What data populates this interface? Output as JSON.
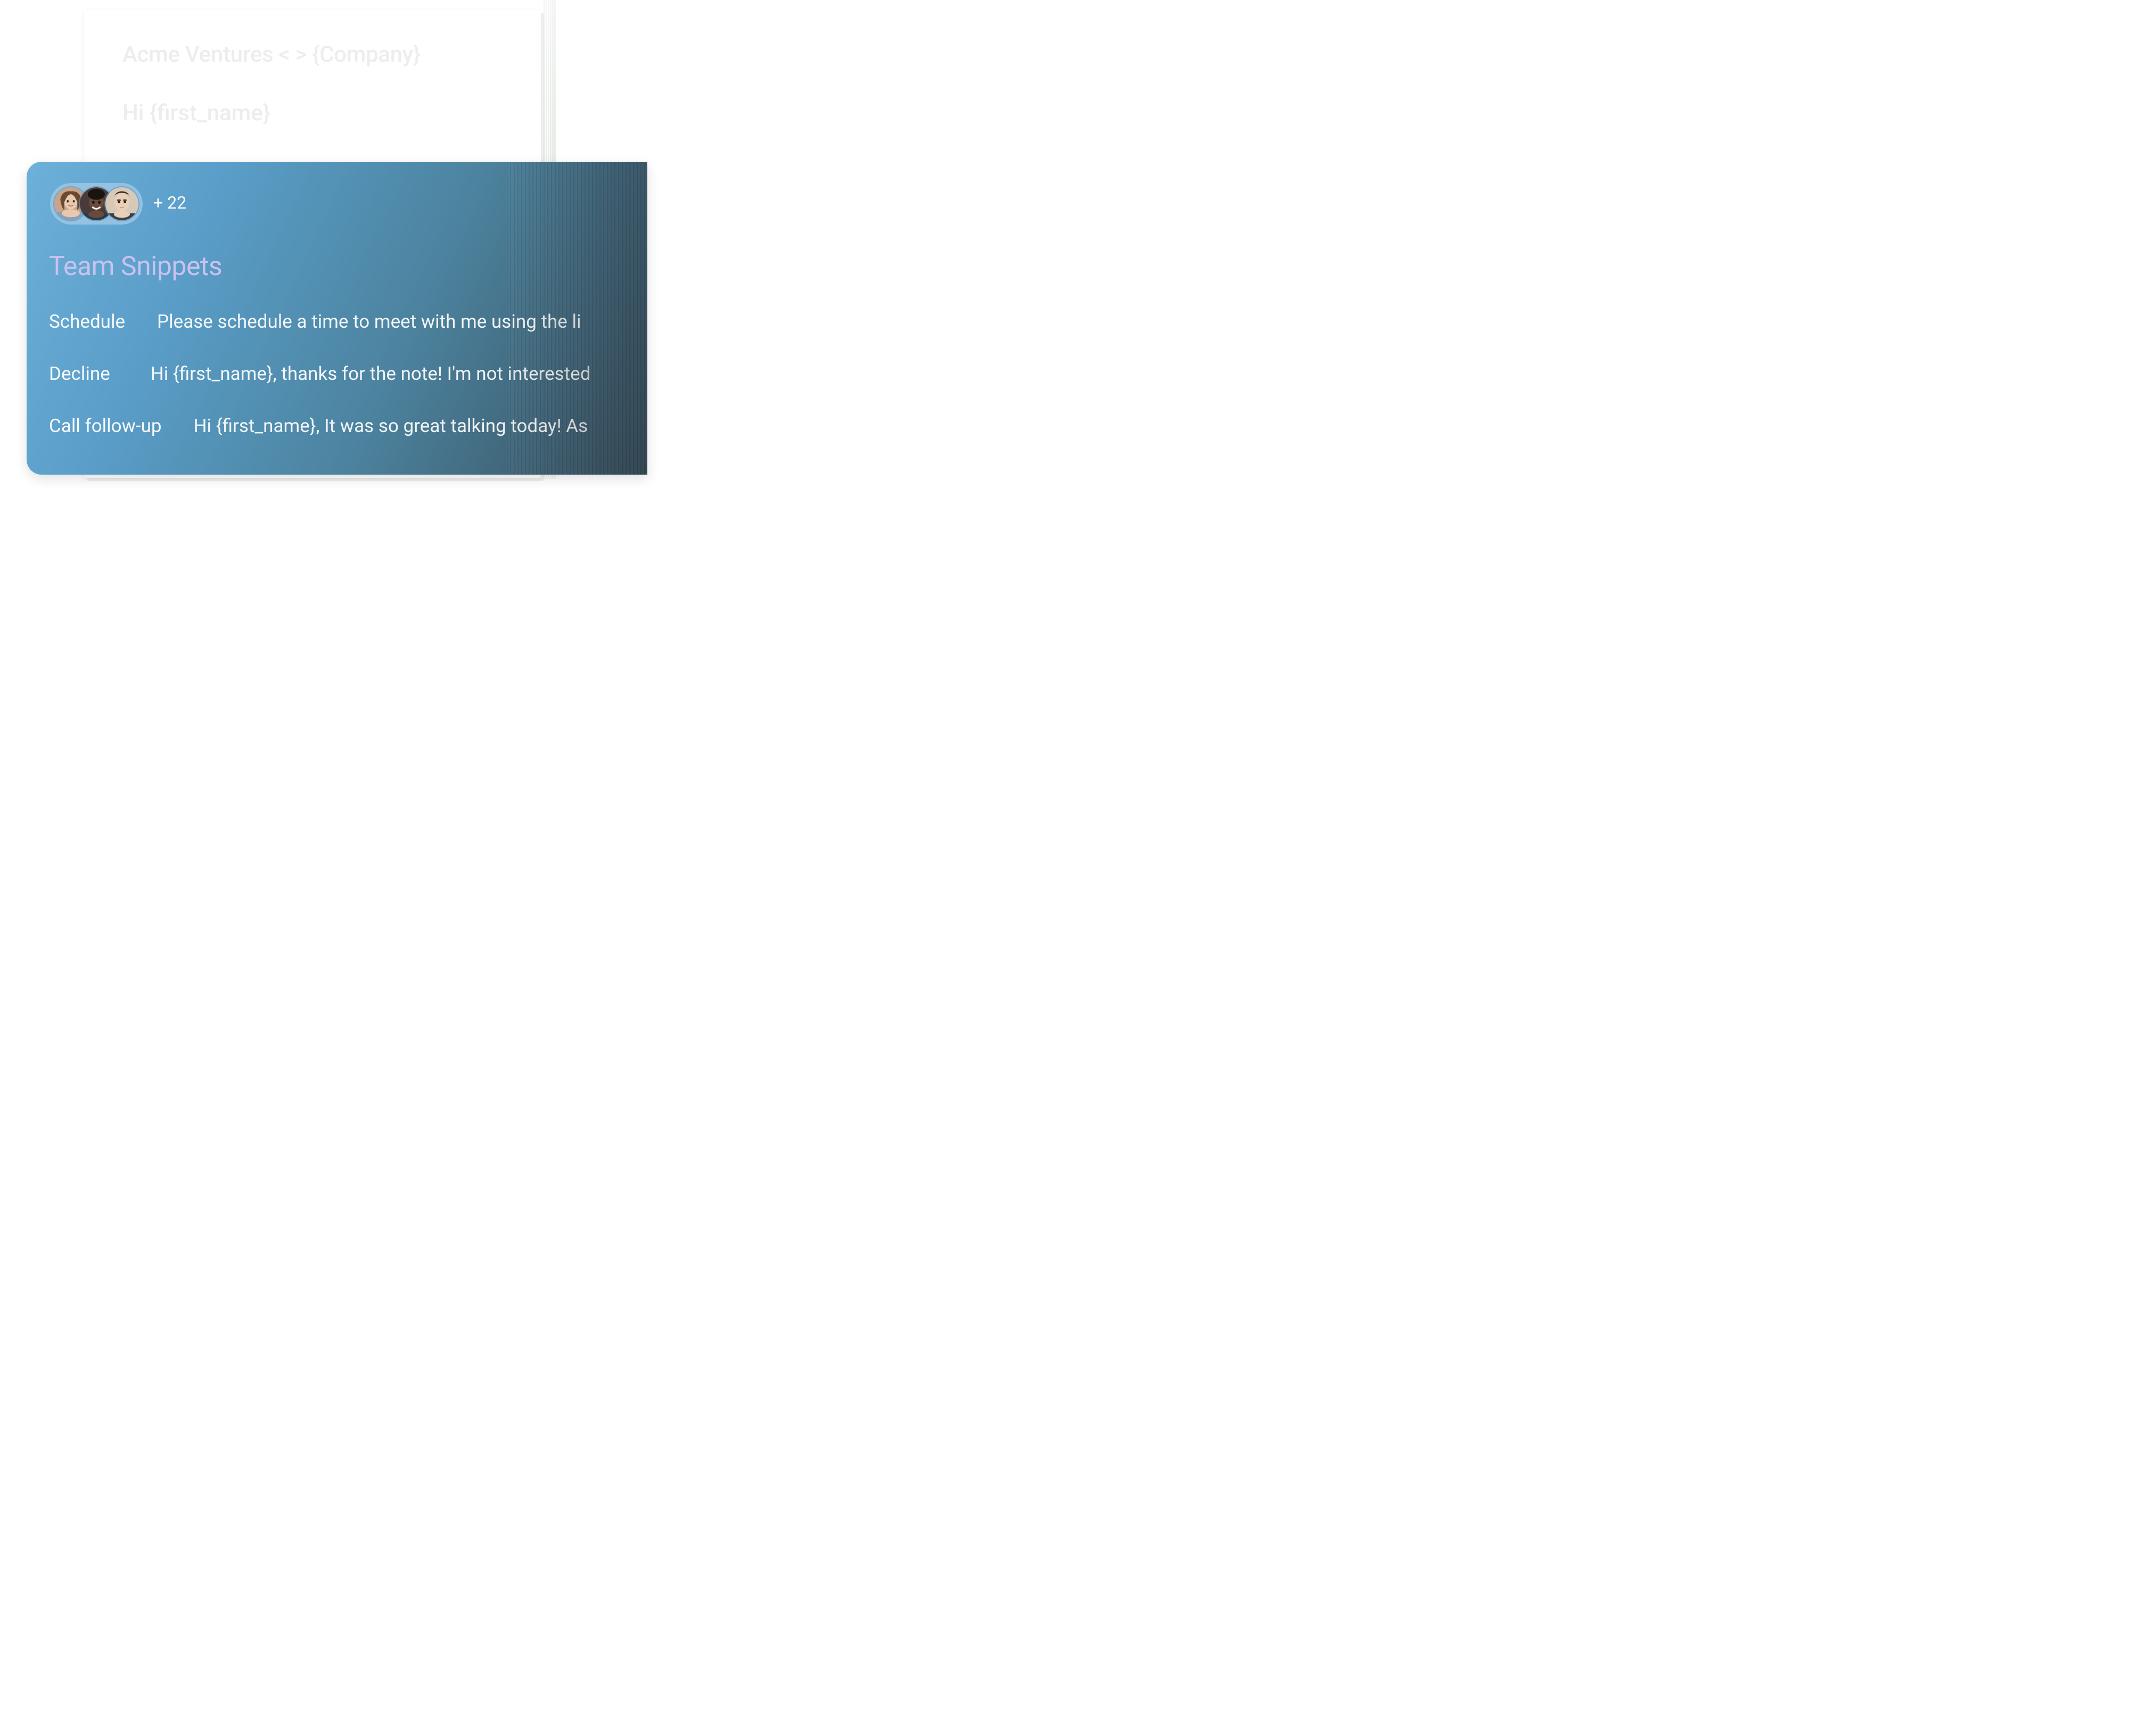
{
  "document": {
    "title": "Acme Ventures < > {Company}",
    "greeting": "Hi {first_name}"
  },
  "panel": {
    "title": "Team Snippets",
    "avatar_overflow": "+ 22",
    "snippets": [
      {
        "label": "Schedule",
        "text": "Please schedule a time to meet with me using the li"
      },
      {
        "label": "Decline",
        "text": "Hi {first_name}, thanks for the note! I'm not interested"
      },
      {
        "label": "Call follow-up",
        "text": "Hi {first_name}, It was so great talking today! As"
      }
    ]
  }
}
